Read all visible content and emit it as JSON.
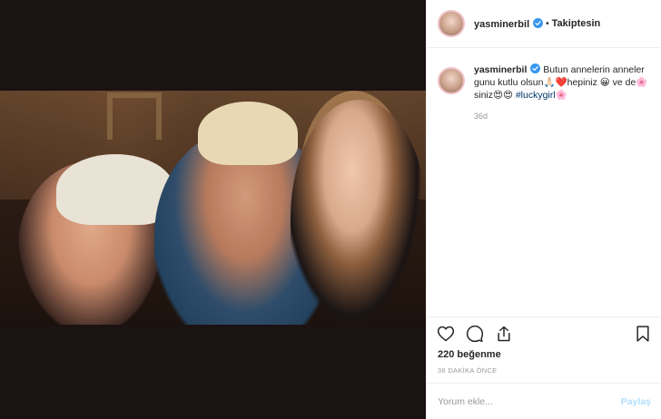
{
  "header": {
    "username": "yasminerbil",
    "separator": "•",
    "follow_status": "Takiptesin"
  },
  "caption": {
    "username": "yasminerbil",
    "text_line": "Butun annelerin anneler gunu kutlu olsun🙏🏻❤️hepiniz 😀 ve de🌸siniz😍😍 ",
    "hashtag": "#luckygirl🌸",
    "time": "36d"
  },
  "post": {
    "likes": "220 beğenme",
    "time_ago": "36 DAKİKA ÖNCE"
  },
  "comment": {
    "placeholder": "Yorum ekle...",
    "share_label": "Paylaş"
  },
  "icons": {
    "heart": "heart-icon",
    "comment": "comment-icon",
    "share": "share-icon",
    "save": "bookmark-icon",
    "verified": "verified-badge-icon"
  },
  "colors": {
    "verified": "#3897f0",
    "hashtag": "#003569",
    "muted": "#999999",
    "share_disabled": "#b2dffc"
  }
}
